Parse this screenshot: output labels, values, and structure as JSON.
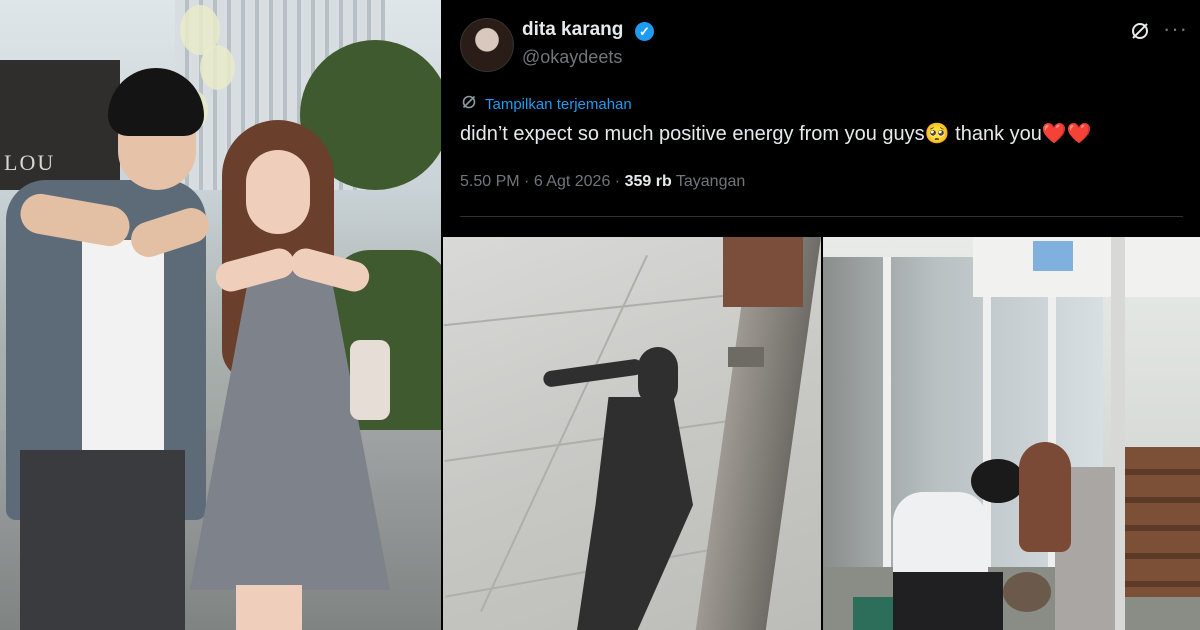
{
  "tweet": {
    "display_name": "dita karang",
    "verified_icon": "✓",
    "handle": "@okaydeets",
    "translate_label": "Tampilkan terjemahan",
    "text": "didn’t expect so much positive energy from you guys🥺 thank you❤️❤️",
    "time": "5.50 PM",
    "date": "6 Agt 2026",
    "views_count": "359 rb",
    "views_label": "Tayangan",
    "colors": {
      "background": "#000000",
      "text": "#e7e9ea",
      "muted": "#71767b",
      "link": "#1d9bf0"
    }
  },
  "photos": {
    "left": {
      "sign_text": "LOU"
    }
  },
  "icons": {
    "grok": "grok-icon",
    "more": "more-icon",
    "translate": "translate-icon",
    "verified": "verified-badge-icon"
  }
}
